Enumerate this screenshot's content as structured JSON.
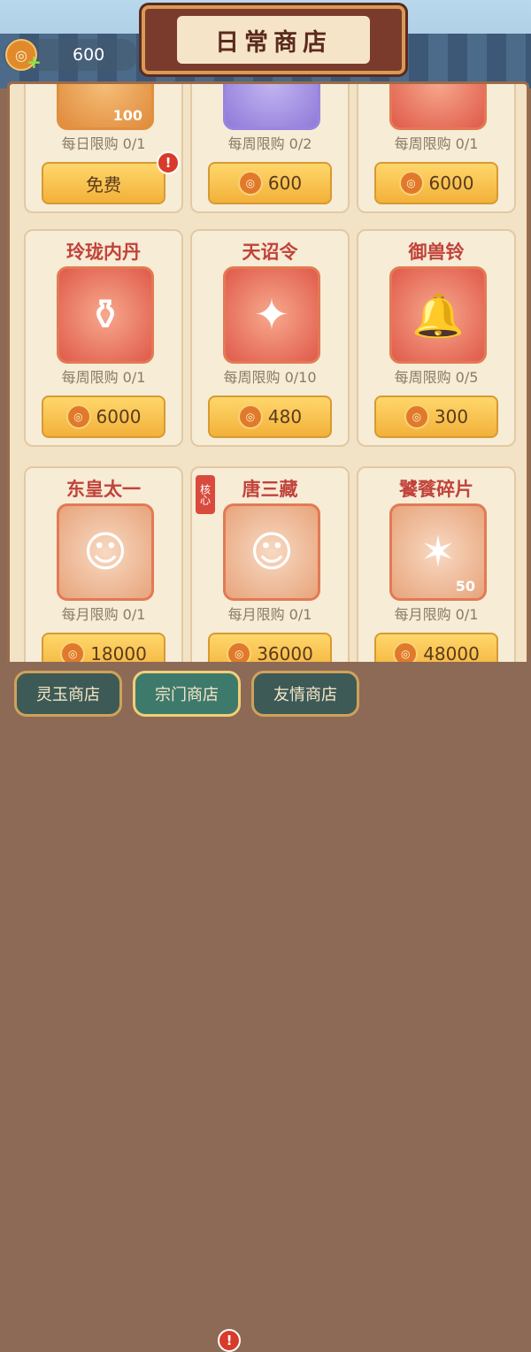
{
  "header": {
    "title": "日常商店",
    "currency_amount": "600"
  },
  "rows": [
    [
      {
        "name": "",
        "limit": "每日限购 0/1",
        "price": "免费",
        "badge": "100",
        "coin": false,
        "alert": true,
        "icon": "gift-icon"
      },
      {
        "name": "",
        "limit": "每周限购 0/2",
        "price": "600",
        "badge": "",
        "coin": true,
        "alert": false,
        "icon": "vase-icon"
      },
      {
        "name": "",
        "limit": "每周限购 0/1",
        "price": "6000",
        "badge": "",
        "coin": true,
        "alert": false,
        "icon": "ornament-icon"
      }
    ],
    [
      {
        "name": "玲珑内丹",
        "limit": "每周限购 0/1",
        "price": "6000",
        "badge": "",
        "coin": true,
        "alert": false,
        "icon": "gourd-icon"
      },
      {
        "name": "天诏令",
        "limit": "每周限购 0/10",
        "price": "480",
        "badge": "",
        "coin": true,
        "alert": false,
        "icon": "token-icon"
      },
      {
        "name": "御兽铃",
        "limit": "每周限购 0/5",
        "price": "300",
        "badge": "",
        "coin": true,
        "alert": false,
        "icon": "bell-icon"
      }
    ],
    [
      {
        "name": "东皇太一",
        "limit": "每月限购 0/1",
        "price": "18000",
        "badge": "",
        "coin": true,
        "alert": false,
        "icon": "hero-portrait-icon"
      },
      {
        "name": "唐三藏",
        "limit": "每月限购 0/1",
        "price": "36000",
        "badge": "",
        "coin": true,
        "alert": false,
        "icon": "monk-portrait-icon",
        "tag": "核心"
      },
      {
        "name": "饕餮碎片",
        "limit": "每月限购 0/1",
        "price": "48000",
        "badge": "50",
        "coin": true,
        "alert": false,
        "icon": "beast-portrait-icon"
      }
    ]
  ],
  "tabs": [
    {
      "label": "灵玉商店",
      "active": false,
      "alert": false
    },
    {
      "label": "宗门商店",
      "active": true,
      "alert": true
    },
    {
      "label": "友情商店",
      "active": false,
      "alert": false
    }
  ],
  "alert_mark": "!"
}
